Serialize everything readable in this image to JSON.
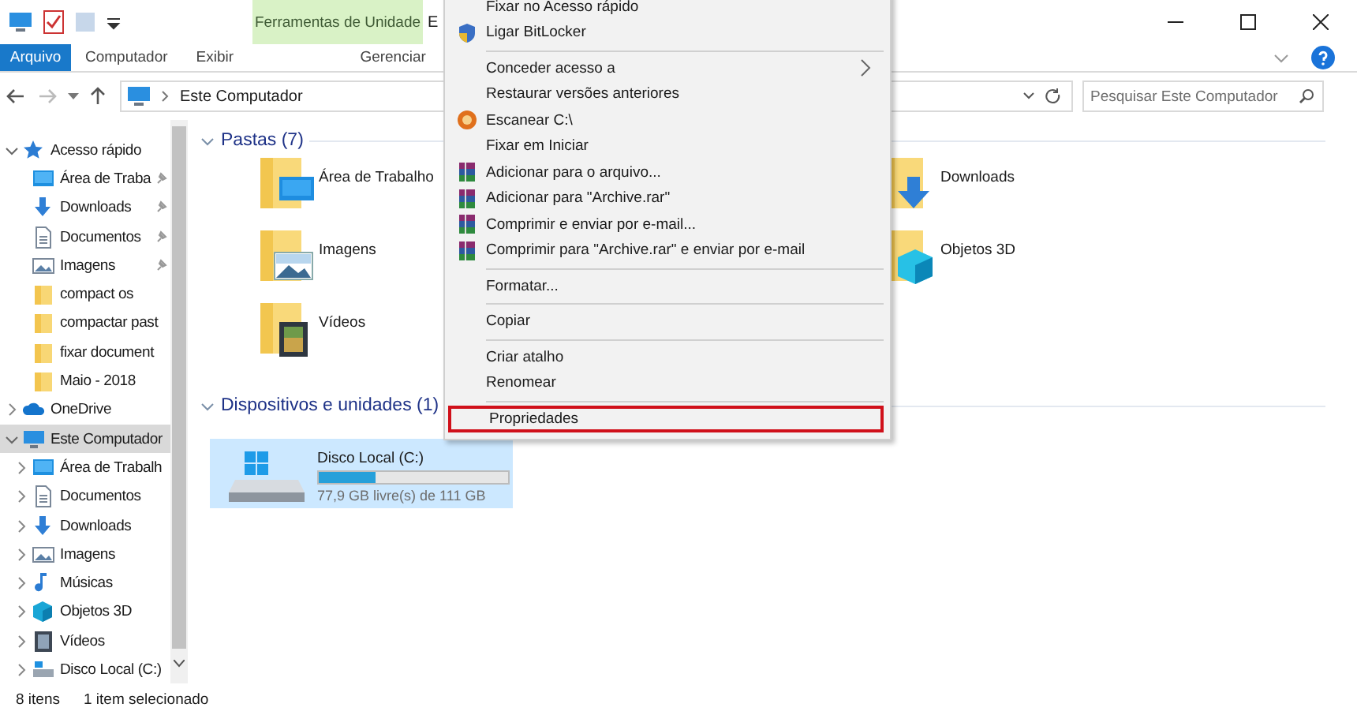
{
  "title_bar": {
    "tool_tab": "Ferramentas de Unidade",
    "title": "E"
  },
  "ribbon_tabs": [
    {
      "label": "Arquivo",
      "kind": "file"
    },
    {
      "label": "Computador",
      "kind": "tab"
    },
    {
      "label": "Exibir",
      "kind": "tab"
    },
    {
      "label": "Gerenciar",
      "kind": "tool"
    }
  ],
  "address_bar": {
    "path": "Este Computador"
  },
  "search": {
    "placeholder": "Pesquisar Este Computador"
  },
  "sidebar": {
    "items": [
      {
        "label": "Acesso rápido",
        "kind": "star",
        "expanded": true,
        "selected": false,
        "children": [
          {
            "label": "Área de Traba",
            "kind": "desktop",
            "pinned": true
          },
          {
            "label": "Downloads",
            "kind": "download",
            "pinned": true
          },
          {
            "label": "Documentos",
            "kind": "document",
            "pinned": true
          },
          {
            "label": "Imagens",
            "kind": "image",
            "pinned": true
          },
          {
            "label": "compact os",
            "kind": "folder",
            "pinned": false
          },
          {
            "label": "compactar past",
            "kind": "folder",
            "pinned": false
          },
          {
            "label": "fixar document",
            "kind": "folder",
            "pinned": false
          },
          {
            "label": "Maio - 2018",
            "kind": "folder",
            "pinned": false
          }
        ]
      },
      {
        "label": "OneDrive",
        "kind": "cloud",
        "expanded": false,
        "selected": false
      },
      {
        "label": "Este Computador",
        "kind": "computer",
        "expanded": true,
        "selected": true,
        "children": [
          {
            "label": "Área de Trabalh",
            "kind": "desktop",
            "expanded": false
          },
          {
            "label": "Documentos",
            "kind": "document",
            "expanded": false
          },
          {
            "label": "Downloads",
            "kind": "download",
            "expanded": false
          },
          {
            "label": "Imagens",
            "kind": "image",
            "expanded": false
          },
          {
            "label": "Músicas",
            "kind": "music",
            "expanded": false
          },
          {
            "label": "Objetos 3D",
            "kind": "cube",
            "expanded": false
          },
          {
            "label": "Vídeos",
            "kind": "video",
            "expanded": false
          },
          {
            "label": "Disco Local (C:)",
            "kind": "drive",
            "expanded": false
          }
        ]
      }
    ]
  },
  "folders": {
    "title": "Pastas (7)",
    "expanded": true,
    "items": [
      {
        "label": "Área de Trabalho",
        "kind": "desktop"
      },
      {
        "label": "Downloads",
        "kind": "download"
      },
      {
        "label": "Imagens",
        "kind": "image"
      },
      {
        "label": "Objetos 3D",
        "kind": "cube"
      },
      {
        "label": "Vídeos",
        "kind": "video"
      }
    ]
  },
  "devices": {
    "title": "Dispositivos e unidades (1)",
    "expanded": true,
    "items": [
      {
        "name": "Disco Local (C:)",
        "level": 0.3,
        "free": "77,9 GB livre(s) de 111 GB",
        "selected": true
      }
    ]
  },
  "context_menu": {
    "items": [
      {
        "kind": "plain",
        "label": "Fixar no Acesso rápido"
      },
      {
        "kind": "shield",
        "label": "Ligar BitLocker"
      },
      {
        "kind": "separator"
      },
      {
        "kind": "plain",
        "label": "Conceder acesso a",
        "submenu": true
      },
      {
        "kind": "plain",
        "label": "Restaurar versões anteriores"
      },
      {
        "kind": "scan",
        "label": "Escanear C:\\"
      },
      {
        "kind": "plain",
        "label": "Fixar em Iniciar"
      },
      {
        "kind": "rar",
        "label": "Adicionar para o arquivo..."
      },
      {
        "kind": "rar",
        "label": "Adicionar para \"Archive.rar\""
      },
      {
        "kind": "rar",
        "label": "Comprimir e enviar por e-mail..."
      },
      {
        "kind": "rar",
        "label": "Comprimir para \"Archive.rar\" e enviar por e-mail"
      },
      {
        "kind": "separator"
      },
      {
        "kind": "plain",
        "label": "Formatar..."
      },
      {
        "kind": "separator"
      },
      {
        "kind": "plain",
        "label": "Copiar"
      },
      {
        "kind": "separator"
      },
      {
        "kind": "plain",
        "label": "Criar atalho"
      },
      {
        "kind": "plain",
        "label": "Renomear"
      },
      {
        "kind": "separator"
      },
      {
        "kind": "plain",
        "label": "Propriedades",
        "highlighted": true
      }
    ]
  },
  "status_bar": {
    "count": "8 itens",
    "selection": "1 item selecionado"
  }
}
